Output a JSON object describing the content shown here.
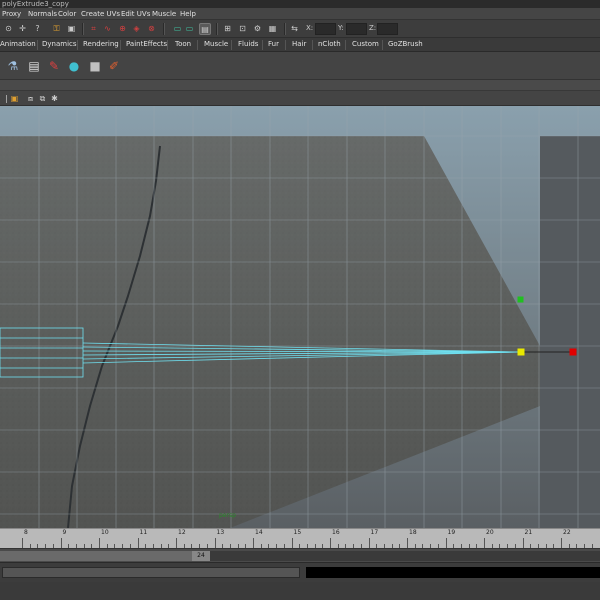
{
  "window": {
    "title": "polyExtrude3_copy"
  },
  "menu": [
    "Proxy",
    "Normals",
    "Color",
    "Create UVs",
    "Edit UVs",
    "Muscle",
    "Help"
  ],
  "status_line": {
    "x_label": "X:",
    "y_label": "Y:",
    "z_label": "Z:",
    "x_value": "",
    "y_value": "",
    "z_value": ""
  },
  "shelf_tabs": [
    "Animation",
    "Dynamics",
    "Rendering",
    "PaintEffects",
    "Toon",
    "Muscle",
    "Fluids",
    "Fur",
    "Hair",
    "nCloth",
    "Custom",
    "GoZBrush"
  ],
  "shelf_icons": [
    "surface-tool-icon",
    "graph-icon",
    "brush-tool-icon",
    "sphere-tool-icon",
    "cube-tool-icon",
    "paint-brush-icon"
  ],
  "viewport": {
    "label": "persp",
    "manipulator_colors": {
      "pivot": "#e8e800",
      "end": "#e00000",
      "up": "#20c020",
      "geometry": "#6fe0f0"
    }
  },
  "time_slider": {
    "ticks": [
      "8",
      "9",
      "10",
      "11",
      "12",
      "13",
      "14",
      "15",
      "16",
      "17",
      "18",
      "19",
      "20",
      "21",
      "22"
    ],
    "range_value": "24"
  },
  "command_line": {
    "input": "",
    "result": ""
  }
}
